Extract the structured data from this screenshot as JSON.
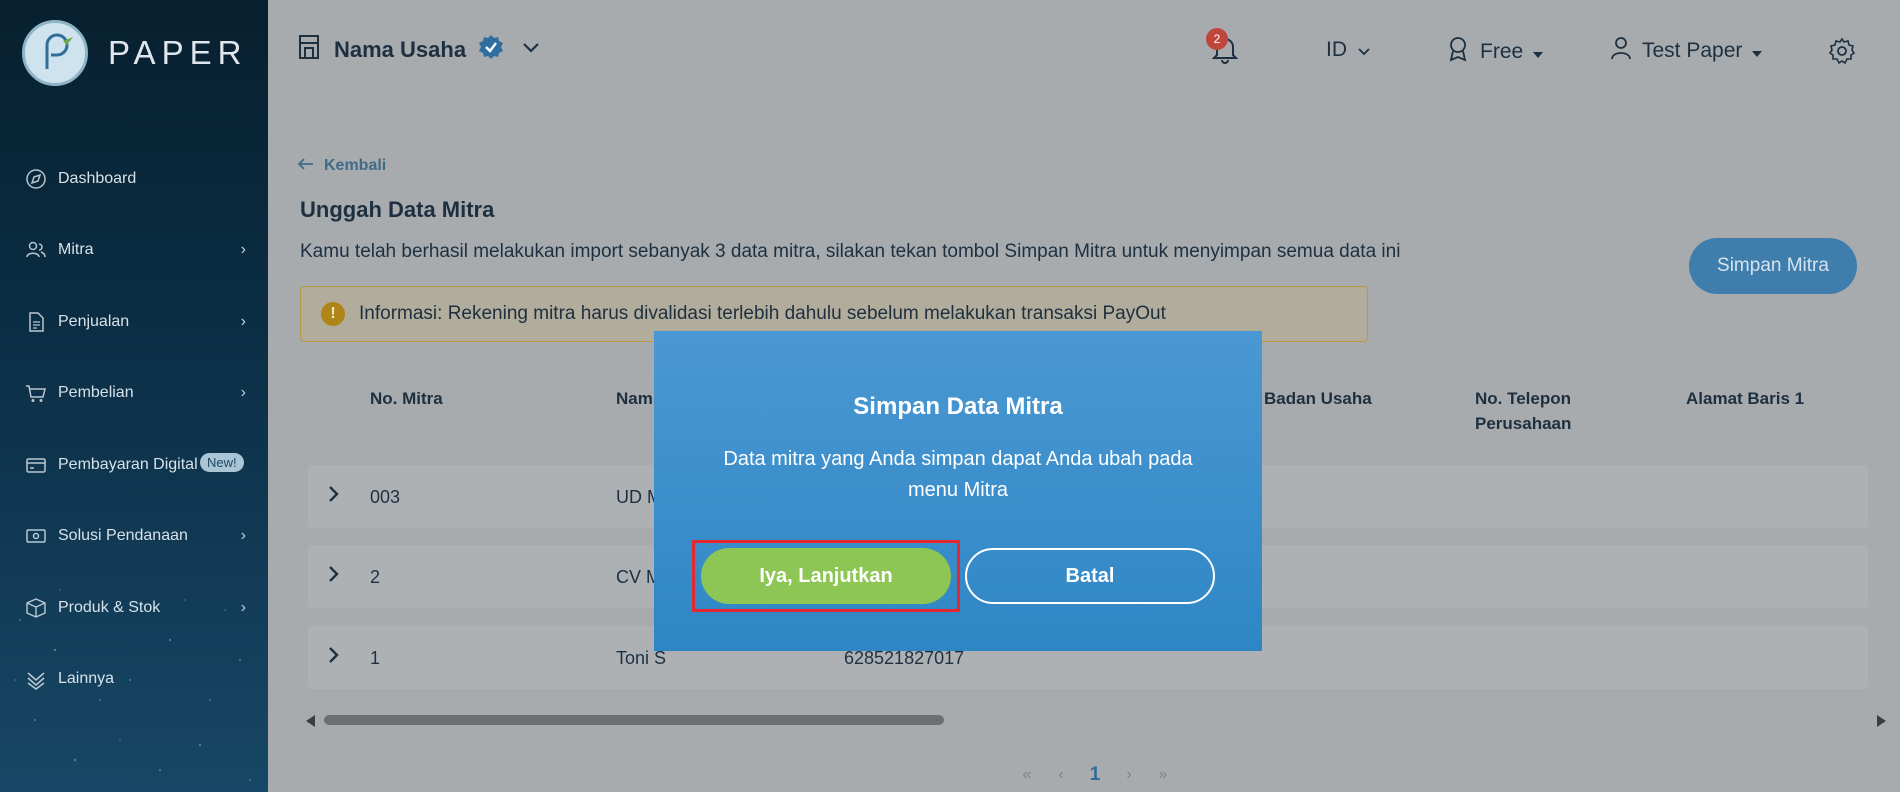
{
  "brand": {
    "name": "PAPER"
  },
  "sidebar": {
    "items": [
      {
        "label": "Dashboard",
        "icon": "compass-icon",
        "chevron": false
      },
      {
        "label": "Mitra",
        "icon": "users-icon",
        "chevron": true
      },
      {
        "label": "Penjualan",
        "icon": "document-icon",
        "chevron": true
      },
      {
        "label": "Pembelian",
        "icon": "cart-icon",
        "chevron": true
      },
      {
        "label": "Pembayaran Digital",
        "icon": "card-icon",
        "chevron": false,
        "badge": "New!"
      },
      {
        "label": "Solusi Pendanaan",
        "icon": "money-icon",
        "chevron": true
      },
      {
        "label": "Produk & Stok",
        "icon": "box-icon",
        "chevron": true
      },
      {
        "label": "Lainnya",
        "icon": "layers-icon",
        "chevron": false
      }
    ]
  },
  "header": {
    "business_name": "Nama Usaha",
    "notification_count": "2",
    "language": "ID",
    "plan": "Free",
    "user_name": "Test Paper"
  },
  "main": {
    "back_label": "Kembali",
    "title": "Unggah Data Mitra",
    "description": "Kamu telah berhasil melakukan import sebanyak 3 data mitra, silakan tekan tombol Simpan Mitra untuk menyimpan semua data ini",
    "save_button": "Simpan Mitra",
    "info_text": "Informasi: Rekening mitra harus divalidasi terlebih dahulu sebelum melakukan transaksi PayOut",
    "table": {
      "headers": [
        "No. Mitra",
        "Nam",
        "Badan Usaha",
        "No. Telepon Perusahaan",
        "Alamat Baris 1"
      ],
      "rows": [
        {
          "no": "003",
          "name": "UD M",
          "phone": ""
        },
        {
          "no": "2",
          "name": "CV M",
          "phone": ""
        },
        {
          "no": "1",
          "name": "Toni S",
          "phone": "628521827017"
        }
      ]
    },
    "pagination": {
      "first": "«",
      "prev": "‹",
      "current": "1",
      "next": "›",
      "last": "»"
    }
  },
  "modal": {
    "title": "Simpan Data Mitra",
    "body": "Data mitra yang Anda simpan dapat Anda ubah pada menu Mitra",
    "confirm_label": "Iya, Lanjutkan",
    "cancel_label": "Batal"
  },
  "colors": {
    "modal_bg": "#3f8fcc",
    "confirm_green": "#8dc655",
    "highlight_red": "#e3282f",
    "sidebar_dark": "#0b2d44"
  }
}
